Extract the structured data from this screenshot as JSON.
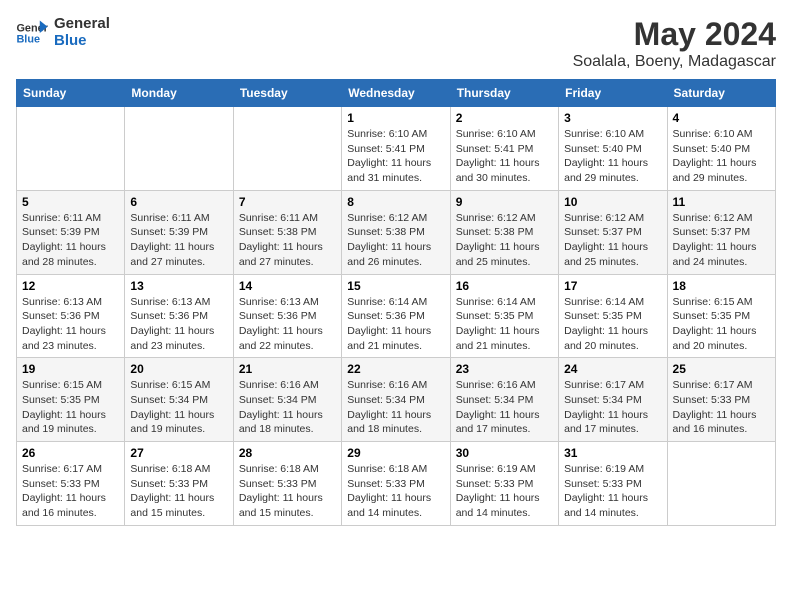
{
  "logo": {
    "text_general": "General",
    "text_blue": "Blue"
  },
  "title": "May 2024",
  "location": "Soalala, Boeny, Madagascar",
  "days_header": [
    "Sunday",
    "Monday",
    "Tuesday",
    "Wednesday",
    "Thursday",
    "Friday",
    "Saturday"
  ],
  "weeks": [
    [
      {
        "day": "",
        "sunrise": "",
        "sunset": "",
        "daylight": ""
      },
      {
        "day": "",
        "sunrise": "",
        "sunset": "",
        "daylight": ""
      },
      {
        "day": "",
        "sunrise": "",
        "sunset": "",
        "daylight": ""
      },
      {
        "day": "1",
        "sunrise": "6:10 AM",
        "sunset": "5:41 PM",
        "daylight": "11 hours and 31 minutes."
      },
      {
        "day": "2",
        "sunrise": "6:10 AM",
        "sunset": "5:41 PM",
        "daylight": "11 hours and 30 minutes."
      },
      {
        "day": "3",
        "sunrise": "6:10 AM",
        "sunset": "5:40 PM",
        "daylight": "11 hours and 29 minutes."
      },
      {
        "day": "4",
        "sunrise": "6:10 AM",
        "sunset": "5:40 PM",
        "daylight": "11 hours and 29 minutes."
      }
    ],
    [
      {
        "day": "5",
        "sunrise": "6:11 AM",
        "sunset": "5:39 PM",
        "daylight": "11 hours and 28 minutes."
      },
      {
        "day": "6",
        "sunrise": "6:11 AM",
        "sunset": "5:39 PM",
        "daylight": "11 hours and 27 minutes."
      },
      {
        "day": "7",
        "sunrise": "6:11 AM",
        "sunset": "5:38 PM",
        "daylight": "11 hours and 27 minutes."
      },
      {
        "day": "8",
        "sunrise": "6:12 AM",
        "sunset": "5:38 PM",
        "daylight": "11 hours and 26 minutes."
      },
      {
        "day": "9",
        "sunrise": "6:12 AM",
        "sunset": "5:38 PM",
        "daylight": "11 hours and 25 minutes."
      },
      {
        "day": "10",
        "sunrise": "6:12 AM",
        "sunset": "5:37 PM",
        "daylight": "11 hours and 25 minutes."
      },
      {
        "day": "11",
        "sunrise": "6:12 AM",
        "sunset": "5:37 PM",
        "daylight": "11 hours and 24 minutes."
      }
    ],
    [
      {
        "day": "12",
        "sunrise": "6:13 AM",
        "sunset": "5:36 PM",
        "daylight": "11 hours and 23 minutes."
      },
      {
        "day": "13",
        "sunrise": "6:13 AM",
        "sunset": "5:36 PM",
        "daylight": "11 hours and 23 minutes."
      },
      {
        "day": "14",
        "sunrise": "6:13 AM",
        "sunset": "5:36 PM",
        "daylight": "11 hours and 22 minutes."
      },
      {
        "day": "15",
        "sunrise": "6:14 AM",
        "sunset": "5:36 PM",
        "daylight": "11 hours and 21 minutes."
      },
      {
        "day": "16",
        "sunrise": "6:14 AM",
        "sunset": "5:35 PM",
        "daylight": "11 hours and 21 minutes."
      },
      {
        "day": "17",
        "sunrise": "6:14 AM",
        "sunset": "5:35 PM",
        "daylight": "11 hours and 20 minutes."
      },
      {
        "day": "18",
        "sunrise": "6:15 AM",
        "sunset": "5:35 PM",
        "daylight": "11 hours and 20 minutes."
      }
    ],
    [
      {
        "day": "19",
        "sunrise": "6:15 AM",
        "sunset": "5:35 PM",
        "daylight": "11 hours and 19 minutes."
      },
      {
        "day": "20",
        "sunrise": "6:15 AM",
        "sunset": "5:34 PM",
        "daylight": "11 hours and 19 minutes."
      },
      {
        "day": "21",
        "sunrise": "6:16 AM",
        "sunset": "5:34 PM",
        "daylight": "11 hours and 18 minutes."
      },
      {
        "day": "22",
        "sunrise": "6:16 AM",
        "sunset": "5:34 PM",
        "daylight": "11 hours and 18 minutes."
      },
      {
        "day": "23",
        "sunrise": "6:16 AM",
        "sunset": "5:34 PM",
        "daylight": "11 hours and 17 minutes."
      },
      {
        "day": "24",
        "sunrise": "6:17 AM",
        "sunset": "5:34 PM",
        "daylight": "11 hours and 17 minutes."
      },
      {
        "day": "25",
        "sunrise": "6:17 AM",
        "sunset": "5:33 PM",
        "daylight": "11 hours and 16 minutes."
      }
    ],
    [
      {
        "day": "26",
        "sunrise": "6:17 AM",
        "sunset": "5:33 PM",
        "daylight": "11 hours and 16 minutes."
      },
      {
        "day": "27",
        "sunrise": "6:18 AM",
        "sunset": "5:33 PM",
        "daylight": "11 hours and 15 minutes."
      },
      {
        "day": "28",
        "sunrise": "6:18 AM",
        "sunset": "5:33 PM",
        "daylight": "11 hours and 15 minutes."
      },
      {
        "day": "29",
        "sunrise": "6:18 AM",
        "sunset": "5:33 PM",
        "daylight": "11 hours and 14 minutes."
      },
      {
        "day": "30",
        "sunrise": "6:19 AM",
        "sunset": "5:33 PM",
        "daylight": "11 hours and 14 minutes."
      },
      {
        "day": "31",
        "sunrise": "6:19 AM",
        "sunset": "5:33 PM",
        "daylight": "11 hours and 14 minutes."
      },
      {
        "day": "",
        "sunrise": "",
        "sunset": "",
        "daylight": ""
      }
    ]
  ]
}
